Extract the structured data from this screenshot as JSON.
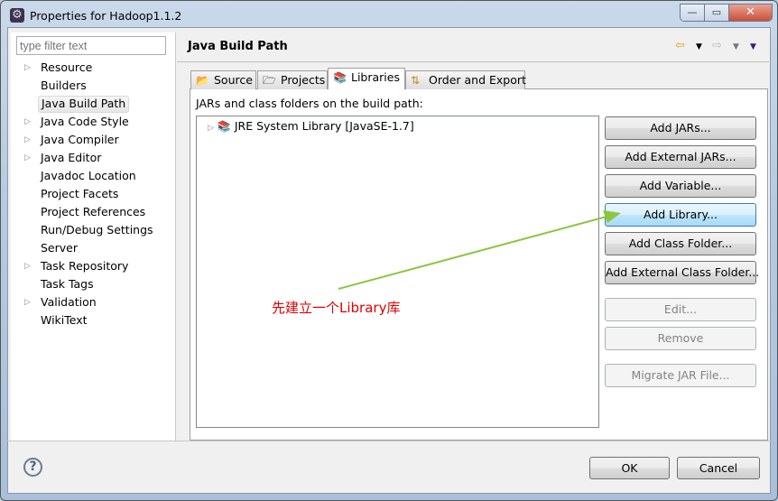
{
  "window": {
    "title": "Properties for Hadoop1.1.2",
    "minimize": "—",
    "maximize": "▭",
    "close": "✕"
  },
  "sidebar": {
    "filter_placeholder": "type filter text",
    "items": [
      {
        "label": "Resource",
        "expandable": true
      },
      {
        "label": "Builders",
        "expandable": false
      },
      {
        "label": "Java Build Path",
        "expandable": false,
        "selected": true
      },
      {
        "label": "Java Code Style",
        "expandable": true
      },
      {
        "label": "Java Compiler",
        "expandable": true
      },
      {
        "label": "Java Editor",
        "expandable": true
      },
      {
        "label": "Javadoc Location",
        "expandable": false
      },
      {
        "label": "Project Facets",
        "expandable": false
      },
      {
        "label": "Project References",
        "expandable": false
      },
      {
        "label": "Run/Debug Settings",
        "expandable": false
      },
      {
        "label": "Server",
        "expandable": false
      },
      {
        "label": "Task Repository",
        "expandable": true
      },
      {
        "label": "Task Tags",
        "expandable": false
      },
      {
        "label": "Validation",
        "expandable": true
      },
      {
        "label": "WikiText",
        "expandable": false
      }
    ]
  },
  "header": {
    "title": "Java Build Path",
    "back": "⇦",
    "forward": "⇨",
    "dropdown": "▼"
  },
  "tabs": [
    {
      "label": "Source",
      "icon": "📂"
    },
    {
      "label": "Projects",
      "icon": "🗁"
    },
    {
      "label": "Libraries",
      "icon": "📚"
    },
    {
      "label": "Order and Export",
      "icon": "⇅"
    }
  ],
  "libraries": {
    "label": "JARs and class folders on the build path:",
    "entries": [
      {
        "label": "JRE System Library [JavaSE-1.7]"
      }
    ]
  },
  "buttons": {
    "add_jars": "Add JARs...",
    "add_external_jars": "Add External JARs...",
    "add_variable": "Add Variable...",
    "add_library": "Add Library...",
    "add_class_folder": "Add Class Folder...",
    "add_external_class_folder": "Add External Class Folder...",
    "edit": "Edit...",
    "remove": "Remove",
    "migrate": "Migrate JAR File..."
  },
  "footer": {
    "help": "?",
    "ok": "OK",
    "cancel": "Cancel"
  },
  "annotation": {
    "text": "先建立一个Library库",
    "color": "#e00000",
    "arrow_color": "#8cc63f"
  }
}
